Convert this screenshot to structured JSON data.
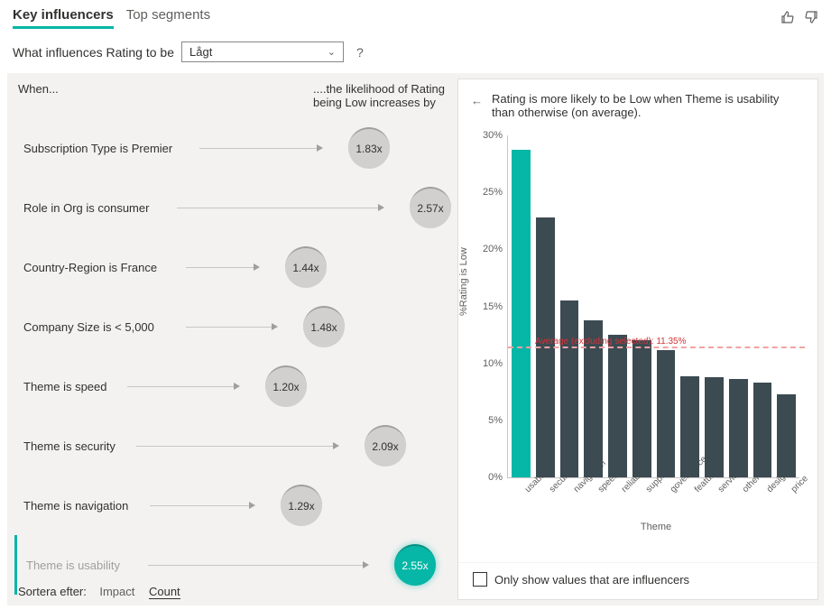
{
  "tabs": {
    "key_influencers": "Key influencers",
    "top_segments": "Top segments"
  },
  "question": {
    "prefix": "What influences Rating to be",
    "selected": "Lågt",
    "help": "?"
  },
  "left": {
    "when": "When...",
    "likelihood": "....the likelihood of Rating being Low increases by",
    "factors": [
      {
        "label": "Subscription Type is Premier",
        "value": "1.83x",
        "pos": 370,
        "line_start": 205,
        "line_end": 335
      },
      {
        "label": "Role in Org is consumer",
        "value": "2.57x",
        "pos": 438,
        "line_start": 180,
        "line_end": 403
      },
      {
        "label": "Country-Region is France",
        "value": "1.44x",
        "pos": 300,
        "line_start": 190,
        "line_end": 265
      },
      {
        "label": "Company Size is < 5,000",
        "value": "1.48x",
        "pos": 320,
        "line_start": 190,
        "line_end": 285
      },
      {
        "label": "Theme is speed",
        "value": "1.20x",
        "pos": 278,
        "line_start": 125,
        "line_end": 243
      },
      {
        "label": "Theme is security",
        "value": "2.09x",
        "pos": 388,
        "line_start": 135,
        "line_end": 353
      },
      {
        "label": "Theme is navigation",
        "value": "1.29x",
        "pos": 295,
        "line_start": 150,
        "line_end": 260
      },
      {
        "label": "Theme is usability",
        "value": "2.55x",
        "pos": 418,
        "line_start": 145,
        "line_end": 383,
        "selected": true
      }
    ],
    "sort_label": "Sortera efter:",
    "sort_impact": "Impact",
    "sort_count": "Count"
  },
  "right": {
    "title": "Rating is more likely to be Low when Theme is usability than otherwise (on average).",
    "xlabel": "Theme",
    "ylabel": "%Rating is Low",
    "avg_label": "Average (excluding selected): 11.35%",
    "checkbox": "Only show values that are influencers"
  },
  "chart_data": {
    "type": "bar",
    "title": "Rating is more likely to be Low when Theme is usability than otherwise (on average).",
    "xlabel": "Theme",
    "ylabel": "%Rating is Low",
    "ylim": [
      0,
      30
    ],
    "yticks": [
      "0%",
      "5%",
      "10%",
      "15%",
      "20%",
      "25%",
      "30%"
    ],
    "categories": [
      "usability",
      "security",
      "navigation",
      "speed",
      "reliability",
      "support",
      "governance",
      "features",
      "services",
      "other",
      "design",
      "price"
    ],
    "values": [
      28.7,
      22.8,
      15.5,
      13.8,
      12.5,
      12.0,
      11.2,
      8.9,
      8.8,
      8.6,
      8.3,
      7.3
    ],
    "highlight_index": 0,
    "average_excluding_selected": 11.35
  }
}
